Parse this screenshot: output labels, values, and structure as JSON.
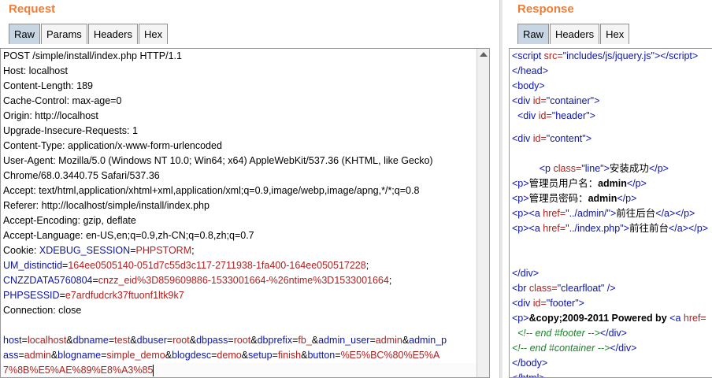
{
  "request": {
    "title": "Request",
    "tabs": [
      "Raw",
      "Params",
      "Headers",
      "Hex"
    ],
    "active_tab": "Raw",
    "lines": [
      "POST /simple/install/index.php HTTP/1.1",
      "Host: localhost",
      "Content-Length: 189",
      "Cache-Control: max-age=0",
      "Origin: http://localhost",
      "Upgrade-Insecure-Requests: 1",
      "Content-Type: application/x-www-form-urlencoded",
      "User-Agent: Mozilla/5.0 (Windows NT 10.0; Win64; x64) AppleWebKit/537.36 (KHTML, like Gecko)",
      "Chrome/68.0.3440.75 Safari/537.36",
      "Accept: text/html,application/xhtml+xml,application/xml;q=0.9,image/webp,image/apng,*/*;q=0.8",
      "Referer: http://localhost/simple/install/index.php",
      "Accept-Encoding: gzip, deflate",
      "Accept-Language: en-US,en;q=0.9,zh-CN;q=0.8,zh;q=0.7"
    ],
    "cookie_label": "Cookie: ",
    "cookie_line1_name": "XDEBUG_SESSION",
    "cookie_line1_val": "PHPSTORM",
    "cookie_line2_name": "UM_distinctid",
    "cookie_line2_val": "164ee0505140-051d7c55d3c117-2711938-1fa400-164ee050517228",
    "cookie_line3_name": "CNZZDATA5760804",
    "cookie_line3_val": "cnzz_eid%3D859609886-1533001664-%26ntime%3D1533001664",
    "cookie_line4_name": "PHPSESSID",
    "cookie_line4_val": "e7ardfudcrk37ftuonf1ltk9k7",
    "connection": "Connection: close",
    "body": {
      "l1": [
        [
          "host",
          "localhost"
        ],
        [
          "dbname",
          "test"
        ],
        [
          "dbuser",
          "root"
        ],
        [
          "dbpass",
          "root"
        ],
        [
          "dbprefix",
          "fb_"
        ],
        [
          "admin_user",
          "admin"
        ]
      ],
      "l1_tail": "admin_p",
      "l2_head": "ass",
      "l2": [
        [
          "admin"
        ],
        [
          "blogname",
          "simple_demo"
        ],
        [
          "blogdesc",
          "demo"
        ],
        [
          "setup",
          "finish"
        ],
        [
          "button",
          "%E5%BC%80%E5%A"
        ]
      ],
      "l3": "7%8B%E5%AE%89%E8%A3%85"
    }
  },
  "response": {
    "title": "Response",
    "tabs": [
      "Raw",
      "Headers",
      "Hex"
    ],
    "active_tab": "Raw",
    "script_src": "includes/js/jquery.js",
    "container_id": "container",
    "header_id": "header",
    "content_id": "content",
    "line_class": "line",
    "install_ok": "安装成功",
    "admin_user_label": "管理员用户名：",
    "admin_pass_label": "管理员密码：",
    "admin_value": "admin",
    "admin_href": "../admin/",
    "admin_link": "前往后台",
    "index_href": "../index.php",
    "index_link": "前往前台",
    "clearfloat": "clearfloat",
    "footer_id": "footer",
    "copyright": "&amp;copy;2009-2011 Powered by",
    "comment_footer": "<!-- end #footer -->",
    "comment_container": "<!-- end #container -->"
  }
}
